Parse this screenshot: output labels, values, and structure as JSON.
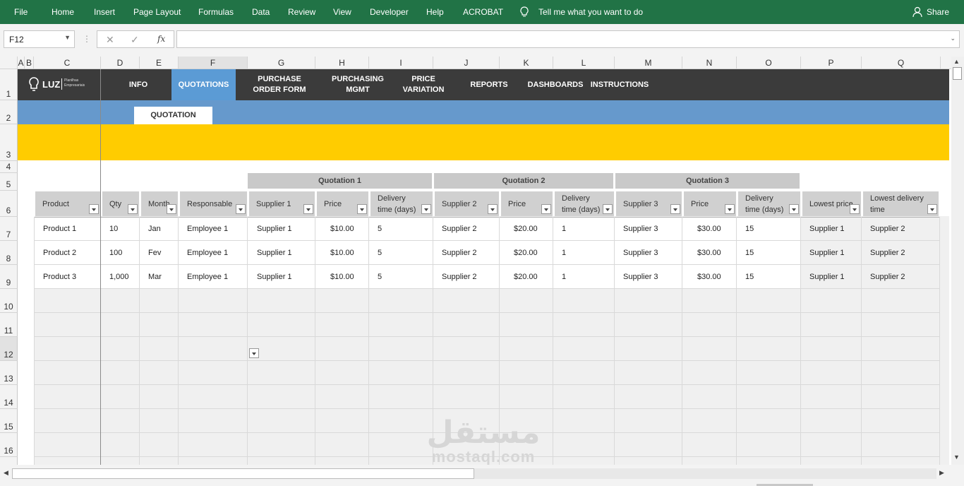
{
  "ribbon": {
    "tabs": [
      "File",
      "Home",
      "Insert",
      "Page Layout",
      "Formulas",
      "Data",
      "Review",
      "View",
      "Developer",
      "Help",
      "ACROBAT"
    ],
    "tell_me": "Tell me what you want to do",
    "share": "Share"
  },
  "formula_bar": {
    "name_box": "F12",
    "fx": "fx",
    "value": ""
  },
  "columns": [
    "A",
    "B",
    "C",
    "D",
    "E",
    "F",
    "G",
    "H",
    "I",
    "J",
    "K",
    "L",
    "M",
    "N",
    "O",
    "P",
    "Q"
  ],
  "rows": [
    "1",
    "2",
    "3",
    "4",
    "5",
    "6",
    "7",
    "8",
    "9",
    "10",
    "11",
    "12",
    "13",
    "14",
    "15",
    "16"
  ],
  "logo": {
    "text": "LUZ",
    "sub1": "Planilhas",
    "sub2": "Empresariais"
  },
  "nav": [
    "INFO",
    "QUOTATIONS",
    "PURCHASE ORDER FORM",
    "PURCHASING MGMT",
    "PRICE VARIATION",
    "REPORTS",
    "DASHBOARDS",
    "INSTRUCTIONS"
  ],
  "subtab": "QUOTATION",
  "colors": {
    "ribbon": "#217346",
    "nav_bar": "#3b3b3b",
    "active_tab": "#5b9bd5",
    "blue_band": "#6699cc",
    "yellow_band": "#ffcc00"
  },
  "quotation_groups": [
    "Quotation 1",
    "Quotation 2",
    "Quotation 3"
  ],
  "headers": [
    "Product",
    "Qty",
    "Month",
    "Responsable",
    "Supplier 1",
    "Price",
    "Delivery time (days)",
    "Supplier 2",
    "Price",
    "Delivery time (days)",
    "Supplier 3",
    "Price",
    "Delivery time (days)",
    "Lowest price",
    "Lowest delivery time"
  ],
  "table_rows": [
    [
      "Product 1",
      "10",
      "Jan",
      "Employee 1",
      "Supplier 1",
      "$10.00",
      "5",
      "Supplier 2",
      "$20.00",
      "1",
      "Supplier 3",
      "$30.00",
      "15",
      "Supplier 1",
      "Supplier 2"
    ],
    [
      "Product 2",
      "100",
      "Fev",
      "Employee 1",
      "Supplier 1",
      "$10.00",
      "5",
      "Supplier 2",
      "$20.00",
      "1",
      "Supplier 3",
      "$30.00",
      "15",
      "Supplier 1",
      "Supplier 2"
    ],
    [
      "Product 3",
      "1,000",
      "Mar",
      "Employee 1",
      "Supplier 1",
      "$10.00",
      "5",
      "Supplier 2",
      "$20.00",
      "1",
      "Supplier 3",
      "$30.00",
      "15",
      "Supplier 1",
      "Supplier 2"
    ]
  ],
  "watermark": {
    "arabic": "مستقل",
    "latin": "mostaql.com"
  }
}
